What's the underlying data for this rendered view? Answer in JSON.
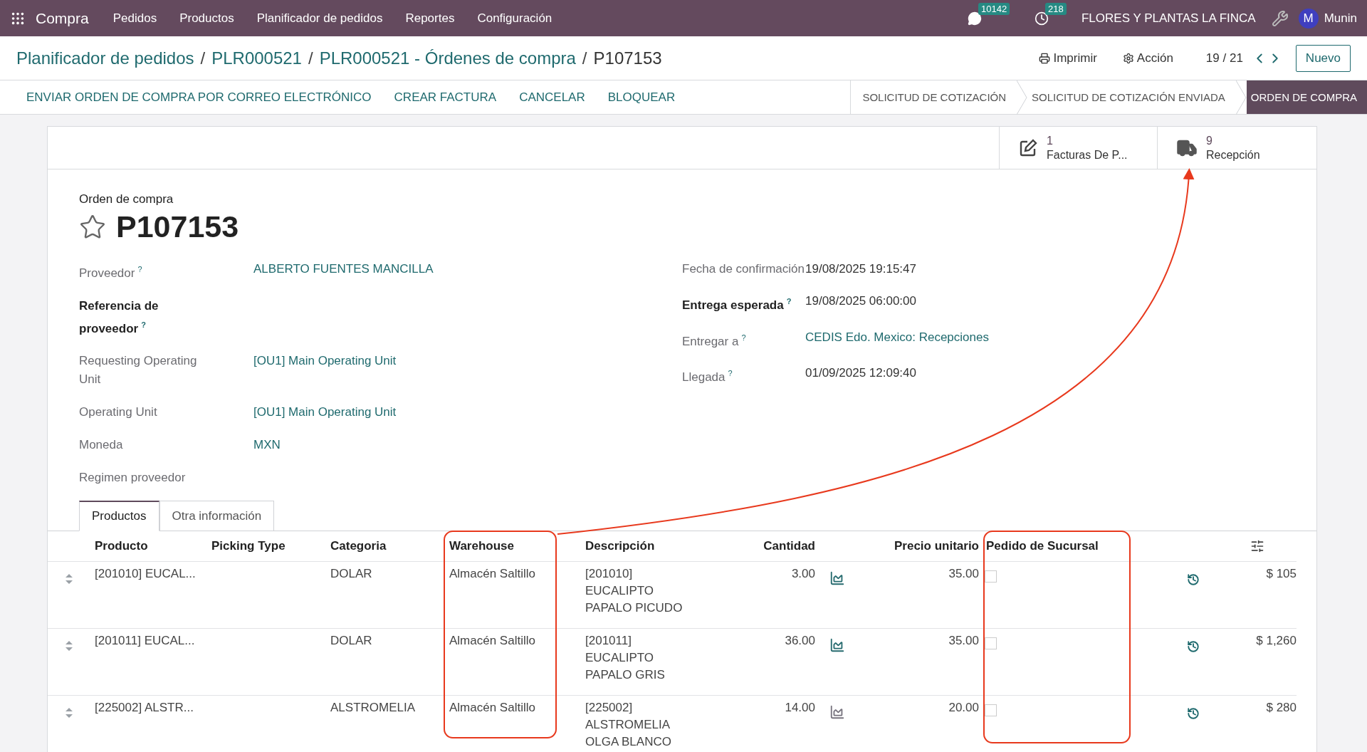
{
  "navbar": {
    "app": "Compra",
    "menu": [
      "Pedidos",
      "Productos",
      "Planificador de pedidos",
      "Reportes",
      "Configuración"
    ],
    "messages_badge": "10142",
    "activities_badge": "218",
    "company": "FLORES Y PLANTAS LA FINCA",
    "avatar_initial": "M",
    "user": "Munin"
  },
  "breadcrumb": {
    "links": [
      "Planificador de pedidos",
      "PLR000521",
      "PLR000521 - Órdenes de compra"
    ],
    "separator": "/",
    "current": "P107153"
  },
  "controls": {
    "print": "Imprimir",
    "action": "Acción",
    "pager": "19 / 21",
    "new": "Nuevo"
  },
  "actions": [
    "ENVIAR ORDEN DE COMPRA POR CORREO ELECTRÓNICO",
    "CREAR FACTURA",
    "CANCELAR",
    "BLOQUEAR"
  ],
  "stages": [
    {
      "label": "SOLICITUD DE COTIZACIÓN",
      "selected": false
    },
    {
      "label": "SOLICITUD DE COTIZACIÓN ENVIADA",
      "selected": false
    },
    {
      "label": "ORDEN DE COMPRA",
      "selected": true
    }
  ],
  "smart_buttons": [
    {
      "kind": "invoice",
      "count": "1",
      "label": "Facturas De P..."
    },
    {
      "kind": "receipt",
      "count": "9",
      "label": "Recepción"
    }
  ],
  "form": {
    "subtitle": "Orden de compra",
    "title": "P107153",
    "favorite": false,
    "left_fields": [
      {
        "label": "Proveedor",
        "help": "?",
        "bold": false,
        "value": "ALBERTO FUENTES MANCILLA",
        "link": true
      },
      {
        "label": "Referencia de proveedor",
        "help": "?",
        "bold": true
      },
      {
        "label": "Requesting Operating Unit",
        "bold": false,
        "value": "[OU1] Main Operating Unit",
        "link": true
      },
      {
        "label": "Operating Unit",
        "bold": false,
        "value": "[OU1] Main Operating Unit",
        "link": true
      },
      {
        "label": "Moneda",
        "bold": false,
        "value": "MXN",
        "link": true
      },
      {
        "label": "Regimen proveedor",
        "bold": false
      }
    ],
    "right_fields": [
      {
        "label": "Fecha de confirmación",
        "bold": false,
        "value": "19/08/2025 19:15:47",
        "link": false
      },
      {
        "label": "Entrega esperada",
        "help": "?",
        "bold": true,
        "value": "19/08/2025 06:00:00",
        "link": false
      },
      {
        "label": "Entregar a",
        "help": "?",
        "bold": false,
        "value": "CEDIS Edo. Mexico: Recepciones",
        "link": true
      },
      {
        "label": "Llegada",
        "help": "?",
        "bold": false,
        "value": "01/09/2025 12:09:40",
        "link": false
      }
    ]
  },
  "tabs": [
    {
      "label": "Productos",
      "selected": true
    },
    {
      "label": "Otra información",
      "selected": false
    }
  ],
  "table": {
    "columns": [
      "Producto",
      "Picking Type",
      "Categoria",
      "Warehouse",
      "Descripción",
      "Cantidad",
      "Precio unitario",
      "Pedido de Sucursal"
    ],
    "rows": [
      {
        "product": "[201010] EUCAL...",
        "category": "DOLAR",
        "warehouse": "Almacén Saltillo",
        "description": [
          "[201010]",
          "EUCALIPTO",
          "PAPALO PICUDO"
        ],
        "quantity": "3.00",
        "color": "#256a6e",
        "price": "35.00",
        "branch_order": false,
        "subtotal": "$ 105"
      },
      {
        "product": "[201011] EUCAL...",
        "category": "DOLAR",
        "warehouse": "Almacén Saltillo",
        "description": [
          "[201011]",
          "EUCALIPTO",
          "PAPALO GRIS"
        ],
        "quantity": "36.00",
        "color": "#256a6e",
        "price": "35.00",
        "branch_order": false,
        "subtotal": "$ 1,260"
      },
      {
        "product": "[225002] ALSTR...",
        "category": "ALSTROMELIA",
        "warehouse": "Almacén Saltillo",
        "description": [
          "[225002]",
          "ALSTROMELIA",
          "OLGA BLANCO"
        ],
        "quantity": "14.00",
        "color": "#77737e",
        "price": "20.00",
        "branch_order": false,
        "subtotal": "$ 280"
      }
    ]
  }
}
